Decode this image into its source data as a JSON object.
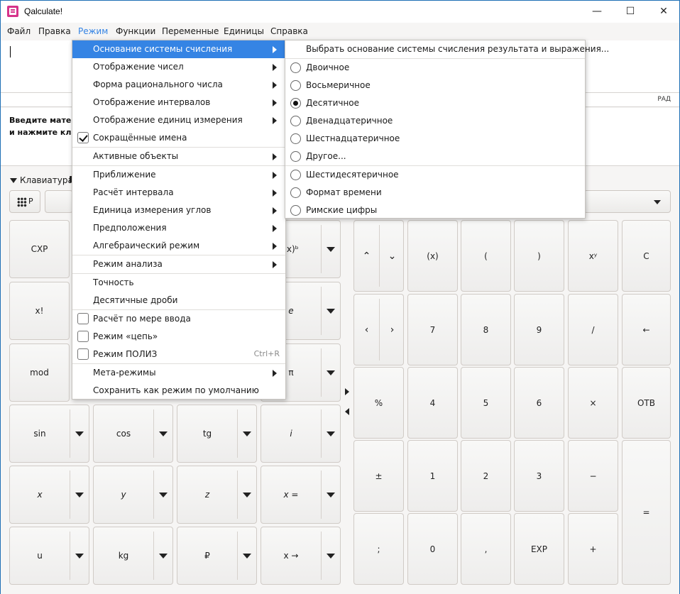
{
  "window": {
    "title": "Qalculate!",
    "min": "—",
    "max": "☐",
    "close": "✕"
  },
  "menubar": [
    "Файл",
    "Правка",
    "Режим",
    "Функции",
    "Переменные",
    "Единицы",
    "Справка"
  ],
  "status": {
    "angle": "РАД"
  },
  "result": {
    "line1": "Введите матема",
    "line2": "и нажмите клави"
  },
  "keypad": {
    "toggle": "Клавиатура",
    "programmer_label": "P",
    "left_keys": [
      [
        "CXP",
        "",
        "",
        "(x)ᵇ"
      ],
      [
        "x!",
        "",
        "",
        "e"
      ],
      [
        "mod",
        "",
        "",
        "π"
      ],
      [
        "sin",
        "cos",
        "tg",
        "i"
      ],
      [
        "x",
        "y",
        "z",
        "x ="
      ],
      [
        "u",
        "kg",
        "₽",
        "x →"
      ]
    ],
    "nav": {
      "up": "⌃",
      "down": "⌄",
      "left": "‹",
      "right": "›"
    },
    "right_keys": {
      "row1": [
        "(x)",
        "(",
        ")",
        "xʸ",
        "C"
      ],
      "row2": [
        "7",
        "8",
        "9",
        "/",
        "←"
      ],
      "row3": [
        "%",
        "4",
        "5",
        "6",
        "×",
        "ОТВ"
      ],
      "row4": [
        "±",
        "1",
        "2",
        "3",
        "−",
        "="
      ],
      "row5": [
        ";",
        "0",
        ",",
        "EXP",
        "+"
      ]
    }
  },
  "mode_menu": {
    "items": [
      {
        "label": "Основание системы счисления",
        "type": "submenu",
        "highlighted": true
      },
      {
        "label": "Отображение чисел",
        "type": "submenu"
      },
      {
        "label": "Форма рационального числа",
        "type": "submenu"
      },
      {
        "label": "Отображение интервалов",
        "type": "submenu"
      },
      {
        "label": "Отображение единиц измерения",
        "type": "submenu"
      },
      {
        "label": "Сокращённые имена",
        "type": "check",
        "checked": true
      },
      {
        "label": "Активные объекты",
        "type": "submenu"
      },
      {
        "label": "Приближение",
        "type": "submenu"
      },
      {
        "label": "Расчёт интервала",
        "type": "submenu"
      },
      {
        "label": "Единица измерения углов",
        "type": "submenu"
      },
      {
        "label": "Предположения",
        "type": "submenu"
      },
      {
        "label": "Алгебраический режим",
        "type": "submenu"
      },
      {
        "label": "Режим анализа",
        "type": "submenu"
      },
      {
        "label": "Точность",
        "type": "plain"
      },
      {
        "label": "Десятичные дроби",
        "type": "plain"
      },
      {
        "label": "Расчёт по мере ввода",
        "type": "check",
        "checked": false
      },
      {
        "label": "Режим «цепь»",
        "type": "check",
        "checked": false
      },
      {
        "label": "Режим ПОЛИЗ",
        "type": "check",
        "checked": false,
        "shortcut": "Ctrl+R"
      },
      {
        "label": "Мета-режимы",
        "type": "submenu"
      },
      {
        "label": "Сохранить как режим по умолчанию",
        "type": "plain"
      }
    ]
  },
  "base_submenu": {
    "header": "Выбрать основание системы счисления результата и выражения...",
    "options": [
      {
        "label": "Двоичное",
        "selected": false
      },
      {
        "label": "Восьмеричное",
        "selected": false
      },
      {
        "label": "Десятичное",
        "selected": true
      },
      {
        "label": "Двенадцатеричное",
        "selected": false
      },
      {
        "label": "Шестнадцатеричное",
        "selected": false
      },
      {
        "label": "Другое...",
        "selected": false
      },
      {
        "label": "Шестидесятеричное",
        "selected": false
      },
      {
        "label": "Формат времени",
        "selected": false
      },
      {
        "label": "Римские цифры",
        "selected": false
      }
    ]
  }
}
